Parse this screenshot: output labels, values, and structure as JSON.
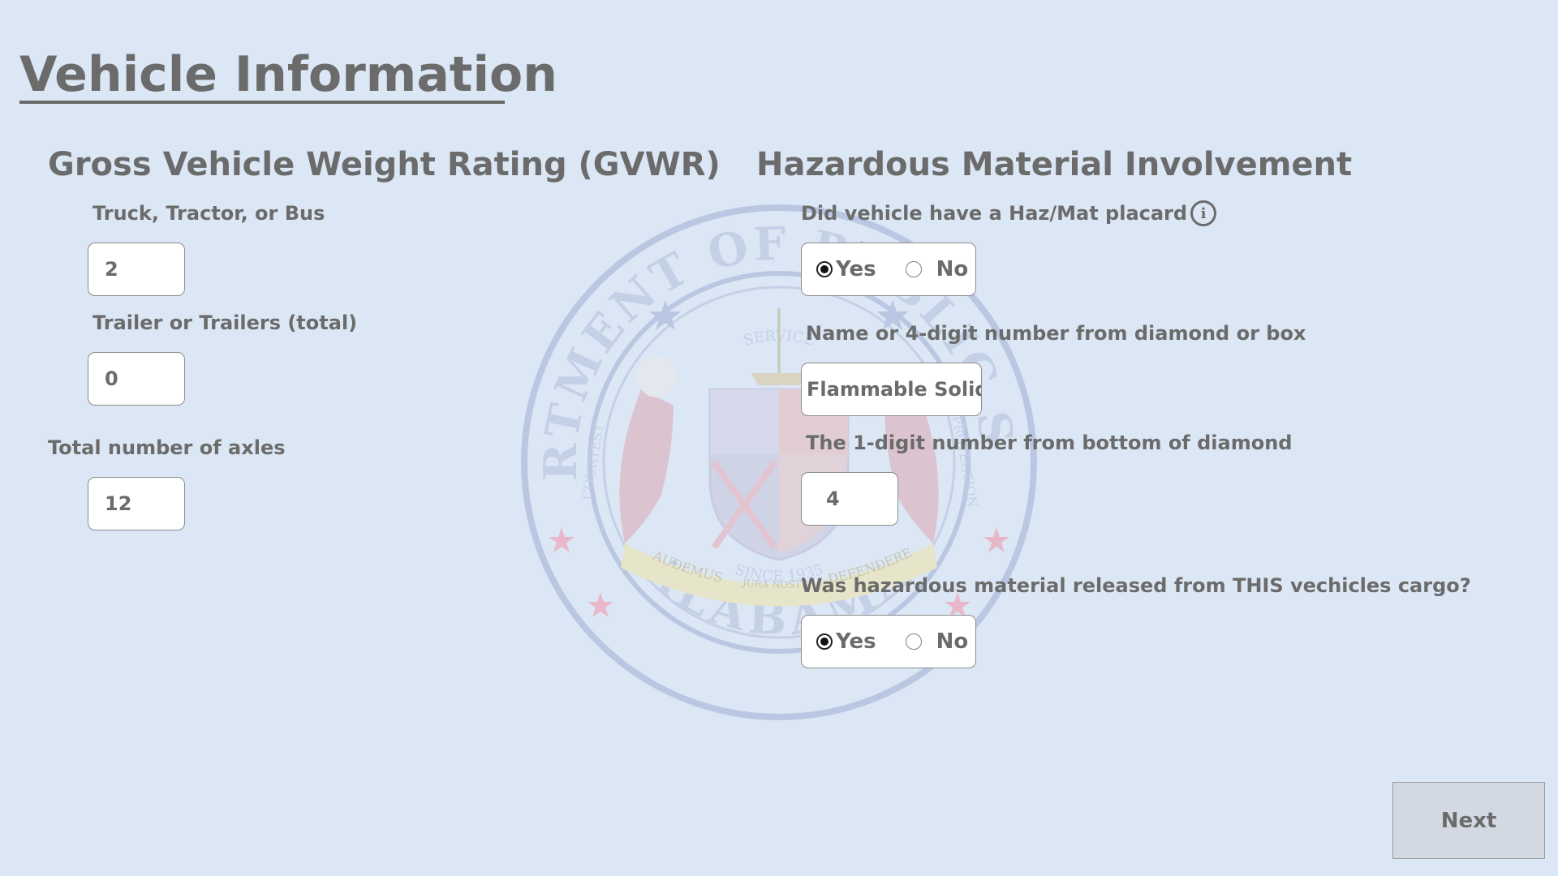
{
  "page": {
    "title": "Vehicle Information"
  },
  "seal": {
    "top_text": "DEPARTMENT OF PUBLIC SAFETY",
    "bottom_text": "ALABAMA",
    "inner_top": "SERVICE",
    "inner_left": "COURTESY",
    "inner_right": "PROTECTION",
    "inner_bottom": "SINCE 1935",
    "motto_left": "AUDEMUS",
    "motto_center": "JURA NOSTRA",
    "motto_right": "DEFENDERE"
  },
  "gvwr": {
    "heading": "Gross Vehicle Weight Rating (GVWR)",
    "truck_label": "Truck, Tractor, or Bus",
    "truck_value": "2",
    "trailer_label": "Trailer or Trailers (total)",
    "trailer_value": "0",
    "axles_label": "Total number of axles",
    "axles_value": "12"
  },
  "hazmat": {
    "heading": "Hazardous Material Involvement",
    "placard_question": "Did vehicle have a Haz/Mat placard",
    "placard_info_icon": "i",
    "placard_yes": "Yes",
    "placard_no": "No",
    "placard_selected": "Yes",
    "name_label": "Name or 4-digit number from diamond or box",
    "name_value": "Flammable Solid",
    "digit_label": "The 1-digit number from bottom of diamond",
    "digit_value": "4",
    "released_question": "Was hazardous material released from THIS vechicles cargo?",
    "released_yes": "Yes",
    "released_no": "No",
    "released_selected": "Yes"
  },
  "footer": {
    "next_label": "Next"
  },
  "colors": {
    "background": "#dce7f5",
    "text": "#6b6b6b",
    "field_bg": "#ffffff",
    "button_bg": "#d3d9e2"
  }
}
